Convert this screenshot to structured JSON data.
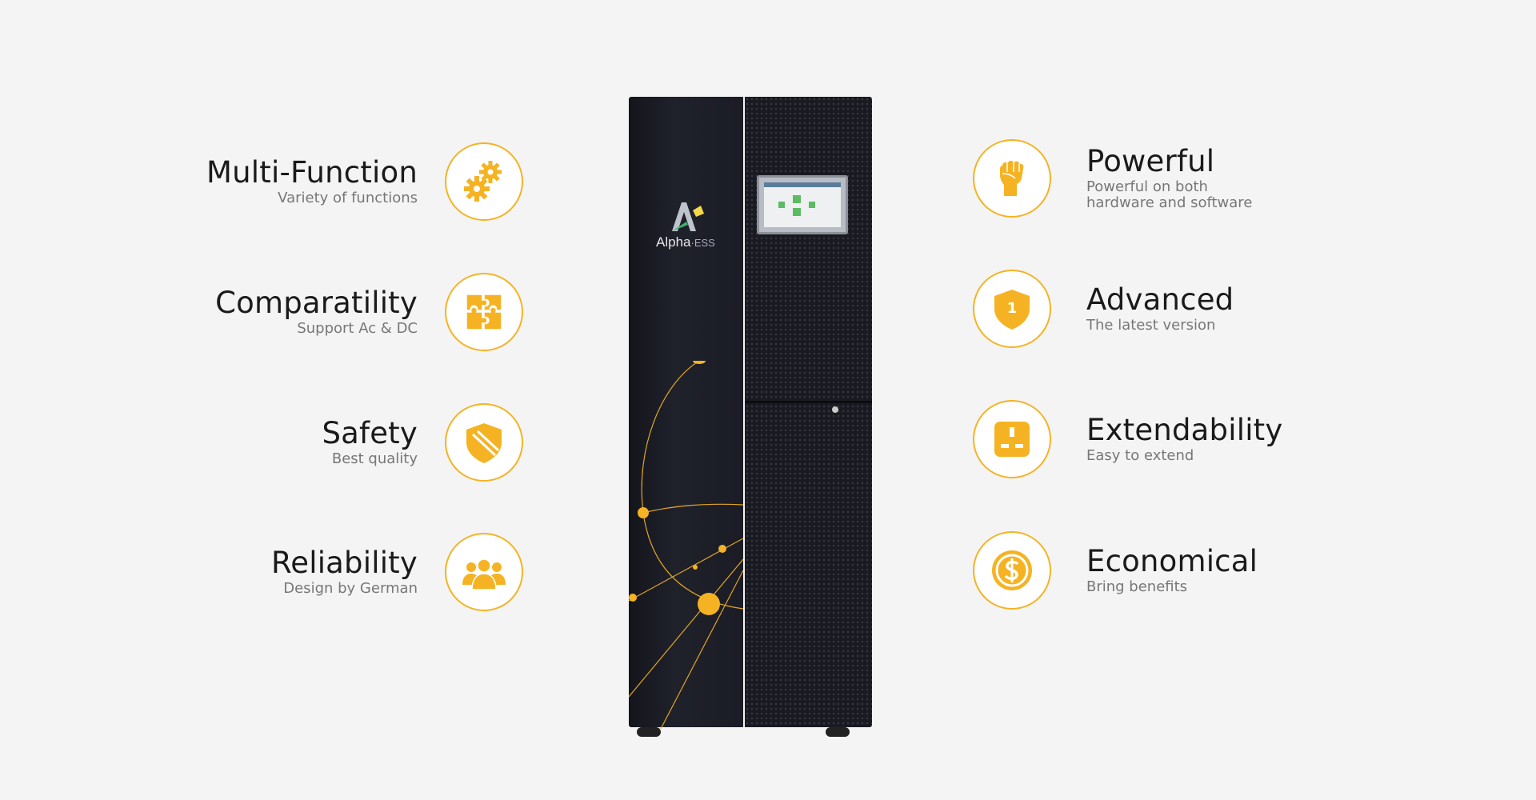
{
  "left_features": [
    {
      "title": "Multi-Function",
      "subtitle": "Variety of functions",
      "icon": "gears-icon"
    },
    {
      "title": "Comparatility",
      "subtitle": "Support Ac & DC",
      "icon": "puzzle-icon"
    },
    {
      "title": "Safety",
      "subtitle": "Best quality",
      "icon": "shield-icon"
    },
    {
      "title": "Reliability",
      "subtitle": "Design by German",
      "icon": "team-icon"
    }
  ],
  "right_features": [
    {
      "title": "Powerful",
      "subtitle": "Powerful on both hardware and software",
      "icon": "fist-icon"
    },
    {
      "title": "Advanced",
      "subtitle": "The latest version",
      "icon": "badge-number-icon"
    },
    {
      "title": "Extendability",
      "subtitle": "Easy to extend",
      "icon": "socket-icon"
    },
    {
      "title": "Economical",
      "subtitle": "Bring benefits",
      "icon": "dollar-coin-icon"
    }
  ],
  "product": {
    "brand": "Alpha",
    "brand_suffix": "·ESS",
    "badge_number": "1"
  },
  "colors": {
    "accent": "#f5b324",
    "background": "#f4f4f4",
    "cabinet": "#1a1b22"
  }
}
